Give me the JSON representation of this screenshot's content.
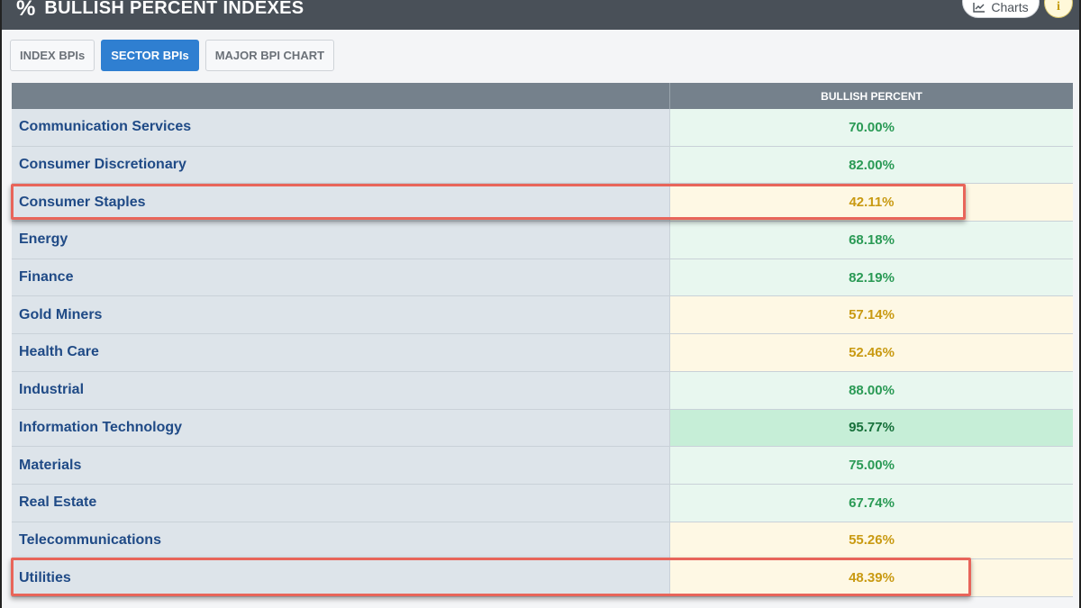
{
  "header": {
    "icon": "percent-icon",
    "title": "BULLISH PERCENT INDEXES",
    "charts_label": "Charts",
    "info_label": "i"
  },
  "tabs": [
    {
      "label": "INDEX BPIs",
      "active": false
    },
    {
      "label": "SECTOR BPIs",
      "active": true
    },
    {
      "label": "MAJOR BPI CHART",
      "active": false
    }
  ],
  "table": {
    "column_header": "BULLISH PERCENT",
    "rows": [
      {
        "name": "Communication Services",
        "value": "70.00%",
        "status": "bull"
      },
      {
        "name": "Consumer Discretionary",
        "value": "82.00%",
        "status": "bull"
      },
      {
        "name": "Consumer Staples",
        "value": "42.11%",
        "status": "neutral",
        "highlighted": true
      },
      {
        "name": "Energy",
        "value": "68.18%",
        "status": "bull"
      },
      {
        "name": "Finance",
        "value": "82.19%",
        "status": "bull"
      },
      {
        "name": "Gold Miners",
        "value": "57.14%",
        "status": "neutral"
      },
      {
        "name": "Health Care",
        "value": "52.46%",
        "status": "neutral"
      },
      {
        "name": "Industrial",
        "value": "88.00%",
        "status": "bull"
      },
      {
        "name": "Information Technology",
        "value": "95.77%",
        "status": "vbull"
      },
      {
        "name": "Materials",
        "value": "75.00%",
        "status": "bull"
      },
      {
        "name": "Real Estate",
        "value": "67.74%",
        "status": "bull"
      },
      {
        "name": "Telecommunications",
        "value": "55.26%",
        "status": "neutral"
      },
      {
        "name": "Utilities",
        "value": "48.39%",
        "status": "neutral",
        "highlighted": true
      }
    ]
  },
  "colors": {
    "header_bg": "#495058",
    "active_tab": "#2f7fd1",
    "bull": "#2a9a55",
    "very_bull": "#16703a",
    "neutral": "#c99a12",
    "highlight": "#e8655a"
  }
}
